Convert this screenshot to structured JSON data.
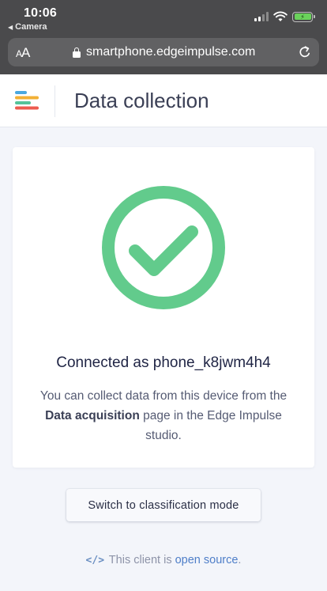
{
  "status_bar": {
    "time": "10:06",
    "back_app": "Camera"
  },
  "browser": {
    "text_size_small": "A",
    "text_size_large": "A",
    "url": "smartphone.edgeimpulse.com"
  },
  "header": {
    "title": "Data collection"
  },
  "card": {
    "connected_prefix": "Connected as ",
    "device_name": "phone_k8jwm4h4",
    "desc_before": "You can collect data from this device from the ",
    "desc_bold": "Data acquisition",
    "desc_after": " page in the Edge Impulse studio."
  },
  "button": {
    "label": "Switch to classification mode"
  },
  "footer": {
    "icon": "</>",
    "text_before": " This client is ",
    "link": "open source",
    "text_after": "."
  },
  "colors": {
    "success": "#62cb8c",
    "link": "#4e7ec8",
    "chrome_bg": "#4a4a4c"
  }
}
